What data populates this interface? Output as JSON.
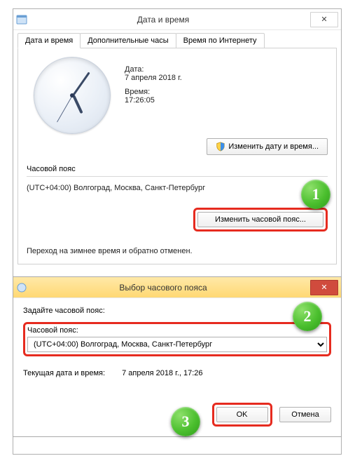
{
  "main_window": {
    "title": "Дата и время",
    "tabs": [
      "Дата и время",
      "Дополнительные часы",
      "Время по Интернету"
    ],
    "date_label": "Дата:",
    "date_value": "7 апреля 2018 г.",
    "time_label": "Время:",
    "time_value": "17:26:05",
    "change_datetime_btn": "Изменить дату и время...",
    "tz_section_label": "Часовой пояс",
    "tz_value": "(UTC+04:00) Волгоград, Москва, Санкт-Петербург",
    "change_tz_btn": "Изменить часовой пояс...",
    "dst_note": "Переход на зимнее время и обратно отменен."
  },
  "tz_dialog": {
    "title": "Выбор часового пояса",
    "prompt": "Задайте часовой пояс:",
    "group_label": "Часовой пояс:",
    "selected": "(UTC+04:00) Волгоград, Москва, Санкт-Петербург",
    "current_label": "Текущая дата и время:",
    "current_value": "7 апреля 2018 г., 17:26",
    "ok": "OK",
    "cancel": "Отмена"
  },
  "markers": {
    "m1": "1",
    "m2": "2",
    "m3": "3"
  }
}
